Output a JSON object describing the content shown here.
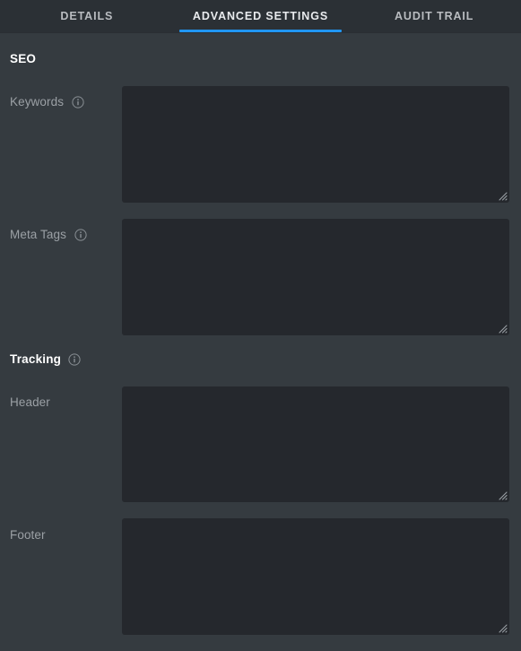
{
  "tabs": [
    {
      "label": "DETAILS",
      "active": false
    },
    {
      "label": "ADVANCED SETTINGS",
      "active": true
    },
    {
      "label": "AUDIT TRAIL",
      "active": false
    }
  ],
  "sections": {
    "seo": {
      "heading": "SEO",
      "fields": {
        "keywords": {
          "label": "Keywords",
          "value": "",
          "placeholder": ""
        },
        "meta_tags": {
          "label": "Meta Tags",
          "value": "",
          "placeholder": ""
        }
      }
    },
    "tracking": {
      "heading": "Tracking",
      "fields": {
        "header": {
          "label": "Header",
          "value": "",
          "placeholder": ""
        },
        "footer": {
          "label": "Footer",
          "value": "",
          "placeholder": ""
        }
      }
    }
  },
  "icons": {
    "info": "info-circle-icon",
    "resize": "resize-grip-icon"
  },
  "colors": {
    "accent": "#2196f3",
    "page_background": "#353b40",
    "tabbar_background": "#2b3035",
    "input_background": "#25282d",
    "label_text": "#9ba0a5",
    "heading_text": "#ffffff"
  }
}
